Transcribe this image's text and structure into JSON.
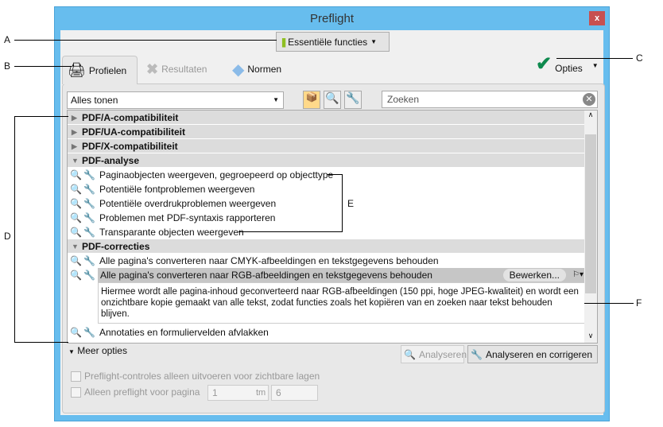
{
  "window": {
    "title": "Preflight",
    "close": "x"
  },
  "toolbar": {
    "essentials": "Essentiële functies"
  },
  "tabs": [
    {
      "label": "Profielen"
    },
    {
      "label": "Resultaten"
    },
    {
      "label": "Normen"
    }
  ],
  "options": {
    "label": "Opties"
  },
  "filter": {
    "value": "Alles tonen"
  },
  "search": {
    "placeholder": "Zoeken"
  },
  "groups": [
    "PDF/A-compatibiliteit",
    "PDF/UA-compatibiliteit",
    "PDF/X-compatibiliteit",
    "PDF-analyse",
    "PDF-correcties"
  ],
  "analysis_items": [
    "Paginaobjecten weergeven, gegroepeerd op objecttype",
    "Potentiële fontproblemen weergeven",
    "Potentiële overdrukproblemen weergeven",
    "Problemen met PDF-syntaxis rapporteren",
    "Transparante objecten weergeven"
  ],
  "fix_items": [
    "Alle pagina's converteren naar CMYK-afbeeldingen en tekstgegevens behouden",
    "Alle pagina's converteren naar RGB-afbeeldingen en tekstgegevens behouden",
    "Annotaties en formuliervelden afvlakken"
  ],
  "selected": {
    "edit": "Bewerken...",
    "description": "Hiermee wordt alle pagina-inhoud geconverteerd naar RGB-afbeeldingen (150 ppi, hoge JPEG-kwaliteit) en wordt een onzichtbare kopie gemaakt van alle tekst, zodat functies zoals het kopiëren van en zoeken naar tekst behouden blijven."
  },
  "more": {
    "label": "Meer opties",
    "analyze": "Analyseren",
    "analyze_fix": "Analyseren en corrigeren",
    "visible_layers": "Preflight-controles alleen uitvoeren voor zichtbare lagen",
    "page_only": "Alleen preflight voor pagina",
    "from": "1",
    "to_label": "tm",
    "to": "6"
  },
  "callouts": {
    "a": "A",
    "b": "B",
    "c": "C",
    "d": "D",
    "e": "E",
    "f": "F"
  }
}
